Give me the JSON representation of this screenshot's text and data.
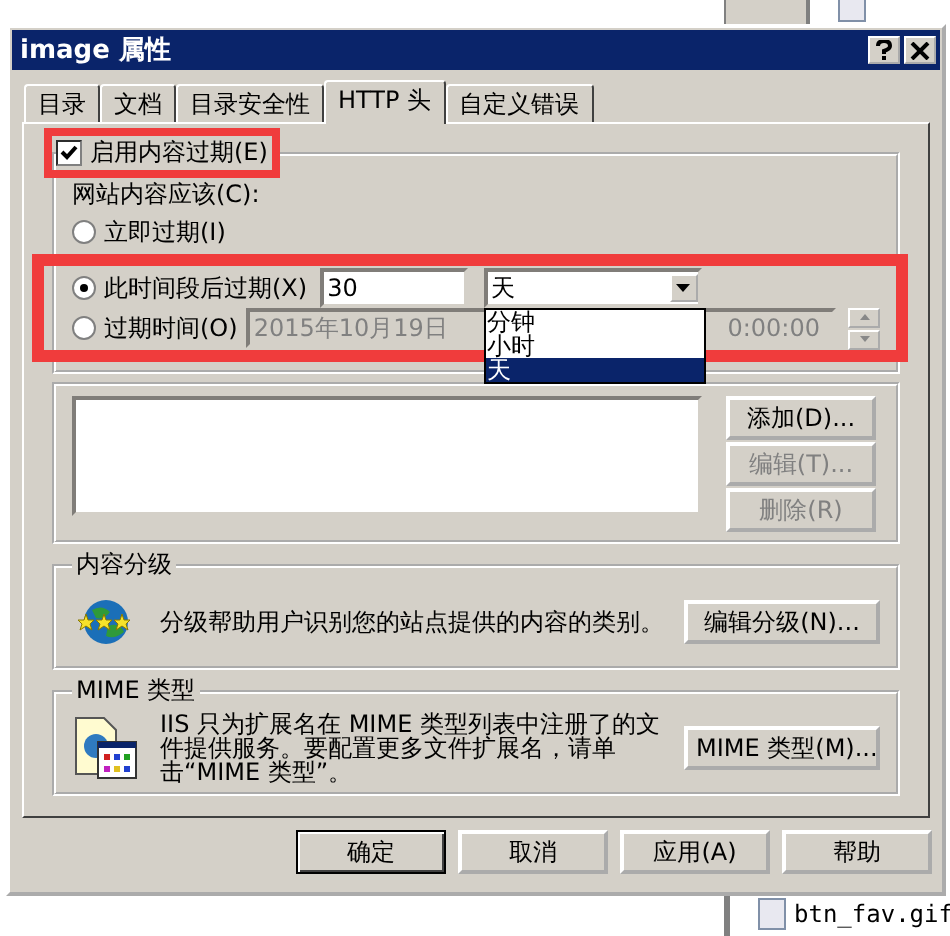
{
  "window": {
    "title": "image 属性"
  },
  "tabs": [
    {
      "label": "目录",
      "selected": false
    },
    {
      "label": "文档",
      "selected": false
    },
    {
      "label": "目录安全性",
      "selected": false
    },
    {
      "label": "HTTP 头",
      "selected": true
    },
    {
      "label": "自定义错误",
      "selected": false
    }
  ],
  "expiration": {
    "label": "启用内容过期(E)",
    "checked": true,
    "highlighted": true,
    "options_highlighted": true,
    "prompt": "网站内容应该(C):",
    "options": [
      {
        "kind": "plain",
        "label": "立即过期(I)",
        "selected": false
      },
      {
        "kind": "duration",
        "label": "此时间段后过期(X)",
        "selected": true
      },
      {
        "kind": "date",
        "label": "过期时间(O)",
        "selected": false
      }
    ],
    "duration_value": "30",
    "unit": "天",
    "unit_options": [
      {
        "label": "分钟",
        "selected": false
      },
      {
        "label": "小时",
        "selected": false
      },
      {
        "label": "天",
        "selected": true
      }
    ],
    "date": "2015年10月19日",
    "time": "0:00:00",
    "date_disabled": true
  },
  "custom_headers": {
    "buttons": [
      {
        "label": "添加(D)...",
        "disabled": false
      },
      {
        "label": "编辑(T)...",
        "disabled": true
      },
      {
        "label": "删除(R)",
        "disabled": true
      }
    ]
  },
  "rating": {
    "title": "内容分级",
    "text": "分级帮助用户识别您的站点提供的内容的类别。",
    "button": "编辑分级(N)..."
  },
  "mime": {
    "title": "MIME 类型",
    "text": "IIS 只为扩展名在 MIME 类型列表中注册了的文件提供服务。要配置更多文件扩展名，请单击“MIME 类型”。",
    "button": "MIME 类型(M)..."
  },
  "buttons": [
    {
      "label": "确定",
      "default": true
    },
    {
      "label": "取消",
      "default": false
    },
    {
      "label": "应用(A)",
      "default": false
    },
    {
      "label": "帮助",
      "default": false
    }
  ],
  "background_files": [
    {
      "name": "btn_fav.gif"
    }
  ]
}
